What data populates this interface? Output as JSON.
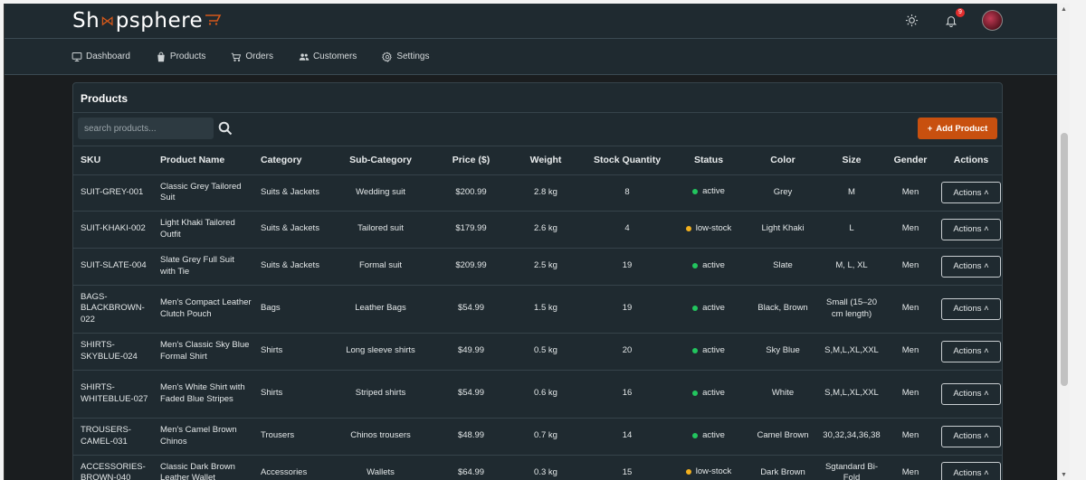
{
  "app": {
    "logo_left": "Sh",
    "logo_right": "psphere",
    "notification_count": "9"
  },
  "nav": [
    {
      "label": "Dashboard",
      "icon": "monitor-icon"
    },
    {
      "label": "Products",
      "icon": "bag-icon"
    },
    {
      "label": "Orders",
      "icon": "cart-icon"
    },
    {
      "label": "Customers",
      "icon": "users-icon"
    },
    {
      "label": "Settings",
      "icon": "gear-icon"
    }
  ],
  "panel": {
    "title": "Products",
    "search_placeholder": "search products...",
    "add_label": "Add Product"
  },
  "columns": [
    "SKU",
    "Product Name",
    "Category",
    "Sub-Category",
    "Price ($)",
    "Weight",
    "Stock Quantity",
    "Status",
    "Color",
    "Size",
    "Gender",
    "Actions"
  ],
  "colors": {
    "active": "#22c55e",
    "low_stock": "#f2b01e",
    "accent": "#c8500f"
  },
  "rows": [
    {
      "sku": "SUIT-GREY-001",
      "name": "Classic Grey Tailored Suit",
      "category": "Suits & Jackets",
      "sub": "Wedding suit",
      "price": "$200.99",
      "weight": "2.8 kg",
      "stock": "8",
      "status": "active",
      "color": "Grey",
      "size": "M",
      "gender": "Men",
      "action": "Actions ˄"
    },
    {
      "sku": "SUIT-KHAKI-002",
      "name": "Light Khaki Tailored Outfit",
      "category": "Suits & Jackets",
      "sub": "Tailored suit",
      "price": "$179.99",
      "weight": "2.6 kg",
      "stock": "4",
      "status": "low-stock",
      "color": "Light Khaki",
      "size": "L",
      "gender": "Men",
      "action": "Actions ˄"
    },
    {
      "sku": "SUIT-SLATE-004",
      "name": "Slate Grey Full Suit with Tie",
      "category": "Suits & Jackets",
      "sub": "Formal suit",
      "price": "$209.99",
      "weight": "2.5 kg",
      "stock": "19",
      "status": "active",
      "color": "Slate",
      "size": "M, L, XL",
      "gender": "Men",
      "action": "Actions ˄"
    },
    {
      "sku": "BAGS-BLACKBROWN-022",
      "name": "Men's Compact Leather Clutch Pouch",
      "category": "Bags",
      "sub": "Leather Bags",
      "price": "$54.99",
      "weight": "1.5 kg",
      "stock": "19",
      "status": "active",
      "color": "Black, Brown",
      "size": "Small (15–20 cm length)",
      "gender": "Men",
      "action": "Actions ˄"
    },
    {
      "sku": "SHIRTS-SKYBLUE-024",
      "name": "Men's Classic Sky Blue Formal Shirt",
      "category": "Shirts",
      "sub": "Long sleeve shirts",
      "price": "$49.99",
      "weight": "0.5 kg",
      "stock": "20",
      "status": "active",
      "color": "Sky Blue",
      "size": "S,M,L,XL,XXL",
      "gender": "Men",
      "action": "Actions ˄"
    },
    {
      "sku": "SHIRTS-WHITEBLUE-027",
      "name": "Men's White Shirt with Faded Blue Stripes",
      "category": "Shirts",
      "sub": "Striped shirts",
      "price": "$54.99",
      "weight": "0.6 kg",
      "stock": "16",
      "status": "active",
      "color": "White",
      "size": "S,M,L,XL,XXL",
      "gender": "Men",
      "action": "Actions ˄"
    },
    {
      "sku": "TROUSERS-CAMEL-031",
      "name": "Men's Camel Brown Chinos",
      "category": "Trousers",
      "sub": "Chinos trousers",
      "price": "$48.99",
      "weight": "0.7 kg",
      "stock": "14",
      "status": "active",
      "color": "Camel Brown",
      "size": "30,32,34,36,38",
      "gender": "Men",
      "action": "Actions ˄"
    },
    {
      "sku": "ACCESSORIES-BROWN-040",
      "name": "Classic Dark Brown Leather Wallet",
      "category": "Accessories",
      "sub": "Wallets",
      "price": "$64.99",
      "weight": "0.3 kg",
      "stock": "15",
      "status": "low-stock",
      "color": "Dark Brown",
      "size": "Sgtandard Bi-Fold",
      "gender": "Men",
      "action": "Actions ˄"
    }
  ]
}
